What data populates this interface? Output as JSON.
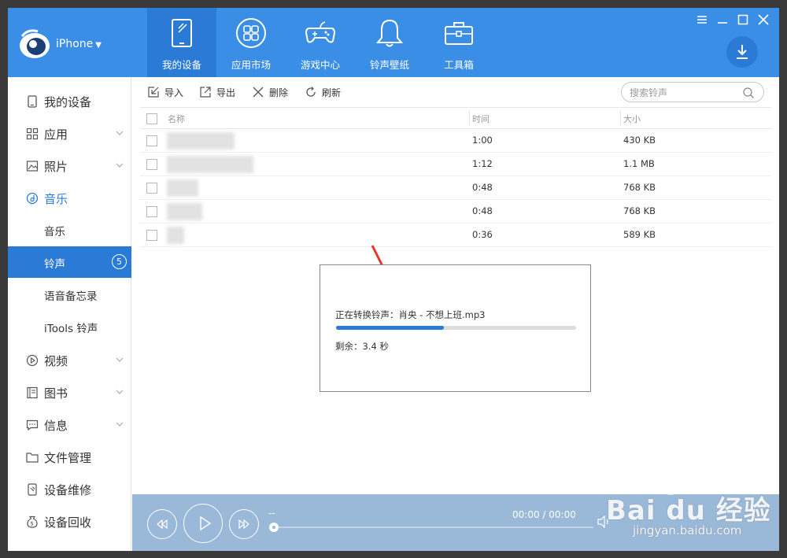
{
  "header": {
    "device_name": "iPhone",
    "tabs": [
      {
        "label": "我的设备",
        "icon": "tablet-icon",
        "active": true
      },
      {
        "label": "应用市场",
        "icon": "apps-grid-icon",
        "active": false
      },
      {
        "label": "游戏中心",
        "icon": "gamepad-icon",
        "active": false
      },
      {
        "label": "铃声壁纸",
        "icon": "bell-icon",
        "active": false
      },
      {
        "label": "工具箱",
        "icon": "toolbox-icon",
        "active": false
      }
    ]
  },
  "sidebar": {
    "items": [
      {
        "label": "我的设备",
        "icon": "device-icon"
      },
      {
        "label": "应用",
        "icon": "apps-icon"
      },
      {
        "label": "照片",
        "icon": "photo-icon"
      },
      {
        "label": "音乐",
        "icon": "music-icon"
      },
      {
        "label": "视频",
        "icon": "video-icon"
      },
      {
        "label": "图书",
        "icon": "book-icon"
      },
      {
        "label": "信息",
        "icon": "message-icon"
      },
      {
        "label": "文件管理",
        "icon": "folder-icon"
      },
      {
        "label": "设备维修",
        "icon": "repair-icon"
      },
      {
        "label": "设备回收",
        "icon": "recycle-icon"
      }
    ],
    "music_sub": [
      {
        "label": "音乐"
      },
      {
        "label": "铃声",
        "badge": "5"
      },
      {
        "label": "语音备忘录"
      },
      {
        "label": "iTools 铃声"
      }
    ]
  },
  "toolbar": {
    "import": "导入",
    "export": "导出",
    "delete": "删除",
    "refresh": "刷新",
    "search_placeholder": "搜索铃声"
  },
  "table": {
    "headers": {
      "name": "名称",
      "time": "时间",
      "size": "大小"
    },
    "rows": [
      {
        "time": "1:00",
        "size": "430 KB"
      },
      {
        "time": "1:12",
        "size": "1.1 MB"
      },
      {
        "time": "0:48",
        "size": "768 KB"
      },
      {
        "time": "0:48",
        "size": "768 KB"
      },
      {
        "time": "0:36",
        "size": "589 KB"
      }
    ]
  },
  "dialog": {
    "message": "正在转换铃声：肖央 - 不想上班.mp3",
    "progress": 0.45,
    "remaining": "剩余：3.4 秒"
  },
  "player": {
    "time": "00:00 / 00:00",
    "track_placeholder": "--"
  },
  "watermark": {
    "brand": "Bai du 经验",
    "url": "jingyan.baidu.com"
  },
  "colors": {
    "header": "#3a8ee6",
    "accent": "#2b7bd6",
    "player": "#9ab8d8"
  }
}
